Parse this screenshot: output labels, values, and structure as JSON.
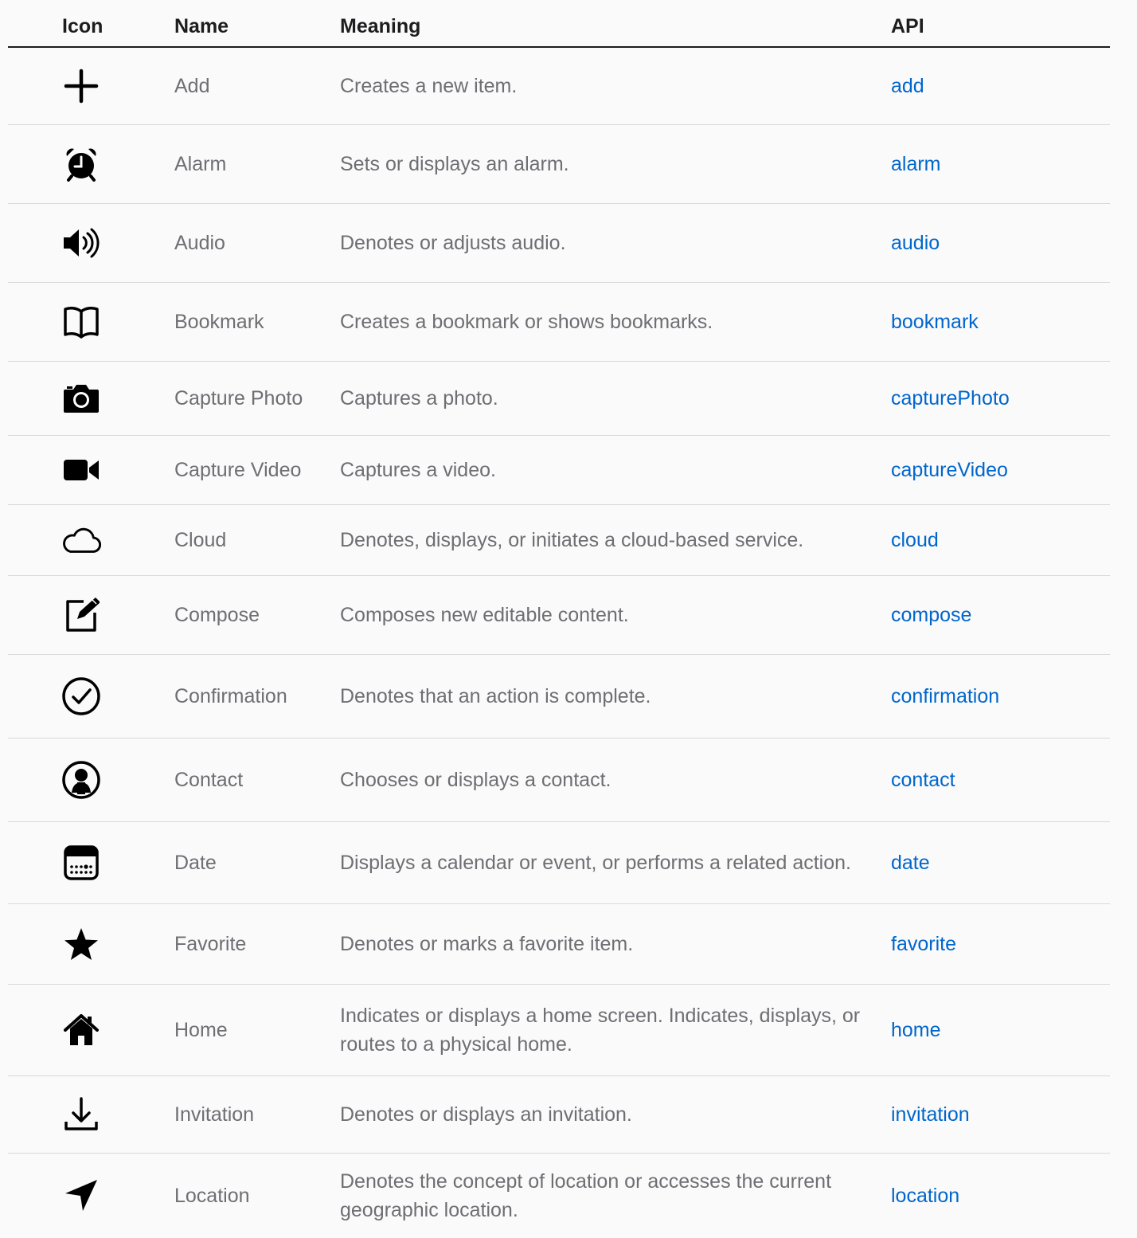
{
  "colors": {
    "accent_link": "#0066cc",
    "text_secondary": "#6e6e73",
    "text_primary": "#1d1d1f",
    "background": "#fafafa"
  },
  "columns": {
    "icon": "Icon",
    "name": "Name",
    "meaning": "Meaning",
    "api": "API"
  },
  "rows": [
    {
      "icon": "plus-icon",
      "name": "Add",
      "meaning": "Creates a new item.",
      "api": "add"
    },
    {
      "icon": "alarm-clock-icon",
      "name": "Alarm",
      "meaning": "Sets or displays an alarm.",
      "api": "alarm"
    },
    {
      "icon": "speaker-icon",
      "name": "Audio",
      "meaning": "Denotes or adjusts audio.",
      "api": "audio"
    },
    {
      "icon": "book-icon",
      "name": "Bookmark",
      "meaning": "Creates a bookmark or shows bookmarks.",
      "api": "bookmark"
    },
    {
      "icon": "camera-icon",
      "name": "Capture Photo",
      "meaning": "Captures a photo.",
      "api": "capturePhoto"
    },
    {
      "icon": "video-camera-icon",
      "name": "Capture Video",
      "meaning": "Captures a video.",
      "api": "captureVideo"
    },
    {
      "icon": "cloud-icon",
      "name": "Cloud",
      "meaning": "Denotes, displays, or initiates a cloud-based service.",
      "api": "cloud"
    },
    {
      "icon": "compose-icon",
      "name": "Compose",
      "meaning": "Composes new editable content.",
      "api": "compose"
    },
    {
      "icon": "checkmark-circle-icon",
      "name": "Confirmation",
      "meaning": "Denotes that an action is complete.",
      "api": "confirmation"
    },
    {
      "icon": "person-circle-icon",
      "name": "Contact",
      "meaning": "Chooses or displays a contact.",
      "api": "contact"
    },
    {
      "icon": "calendar-icon",
      "name": "Date",
      "meaning": "Displays a calendar or event, or performs a related action.",
      "api": "date"
    },
    {
      "icon": "star-icon",
      "name": "Favorite",
      "meaning": "Denotes or marks a favorite item.",
      "api": "favorite"
    },
    {
      "icon": "house-icon",
      "name": "Home",
      "meaning": "Indicates or displays a home screen. Indicates, displays, or routes to a physical home.",
      "api": "home"
    },
    {
      "icon": "download-tray-icon",
      "name": "Invitation",
      "meaning": "Denotes or displays an invitation.",
      "api": "invitation"
    },
    {
      "icon": "location-arrow-icon",
      "name": "Location",
      "meaning": "Denotes the concept of location or accesses the current geographic location.",
      "api": "location"
    }
  ]
}
